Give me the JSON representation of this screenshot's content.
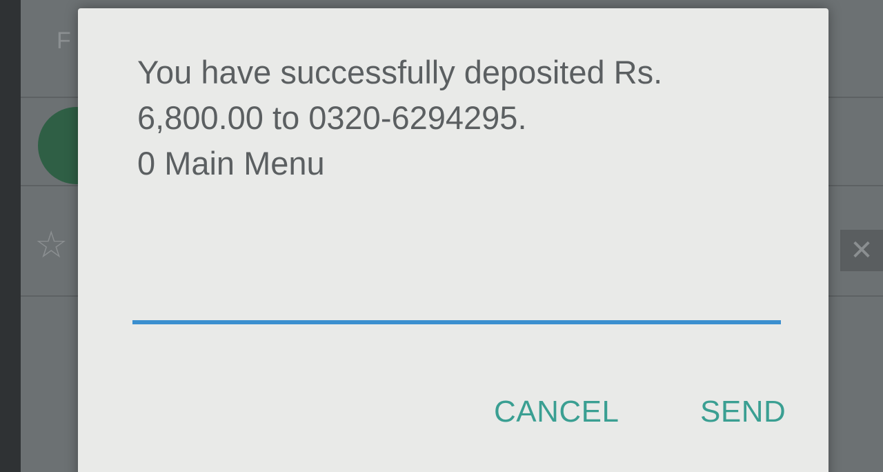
{
  "background": {
    "letter": "F",
    "star_icon": "star-outline-icon",
    "close_icon": "close-icon"
  },
  "dialog": {
    "message_lines": [
      "You have successfully deposited Rs.",
      "6,800.00 to 0320-6294295.",
      "0 Main Menu"
    ],
    "input_value": "",
    "cancel_label": "CANCEL",
    "send_label": "SEND"
  },
  "colors": {
    "accent_button": "#3a9f92",
    "input_underline": "#3b8fcf",
    "dialog_background": "#e9eae8",
    "message_text": "#5b5f61"
  }
}
